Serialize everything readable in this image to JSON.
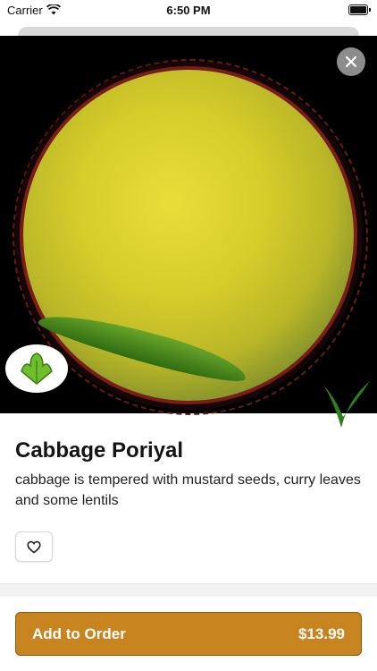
{
  "status_bar": {
    "carrier": "Carrier",
    "time": "6:50 PM"
  },
  "icons": {
    "close": "close-icon",
    "favorite": "heart-icon",
    "wifi": "wifi-icon",
    "battery": "battery-icon",
    "veg_badge": "leaf-icon",
    "veg_mark": "check-mark-icon"
  },
  "dish": {
    "name": "Cabbage Poriyal",
    "description": "cabbage is tempered with mustard seeds, curry leaves and some lentils"
  },
  "order": {
    "label": "Add to Order",
    "price": "$13.99"
  },
  "colors": {
    "accent": "#c8841f",
    "accent_border": "#8a5a12",
    "veg_green": "#2f7d1e"
  }
}
